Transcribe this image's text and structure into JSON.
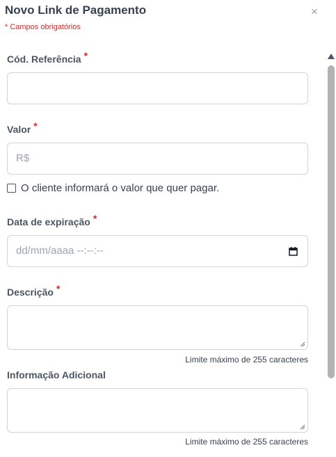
{
  "modal": {
    "title": "Novo Link de Pagamento",
    "close_icon": "close-icon",
    "required_note": "* Campos obrigatórios"
  },
  "form": {
    "reference": {
      "label": "Cód. Referência",
      "required_mark": "*",
      "value": ""
    },
    "amount": {
      "label": "Valor",
      "required_mark": "*",
      "placeholder": "R$",
      "value": ""
    },
    "client_decides": {
      "label": "O cliente informará o valor que quer pagar.",
      "checked": false
    },
    "expiration": {
      "label": "Data de expiração",
      "required_mark": "*",
      "placeholder": "dd/mm/aaaa --:--:--",
      "icon": "calendar-icon"
    },
    "description": {
      "label": "Descrição",
      "required_mark": "*",
      "value": "",
      "helper": "Limite máximo de 255 caracteres"
    },
    "additional_info": {
      "label": "Informação Adicional",
      "value": "",
      "helper": "Limite máximo de 255 caracteres"
    }
  },
  "colors": {
    "required": "#dc2626",
    "label": "#4b5563",
    "border": "#d1d5db",
    "placeholder": "#9ca3af"
  }
}
